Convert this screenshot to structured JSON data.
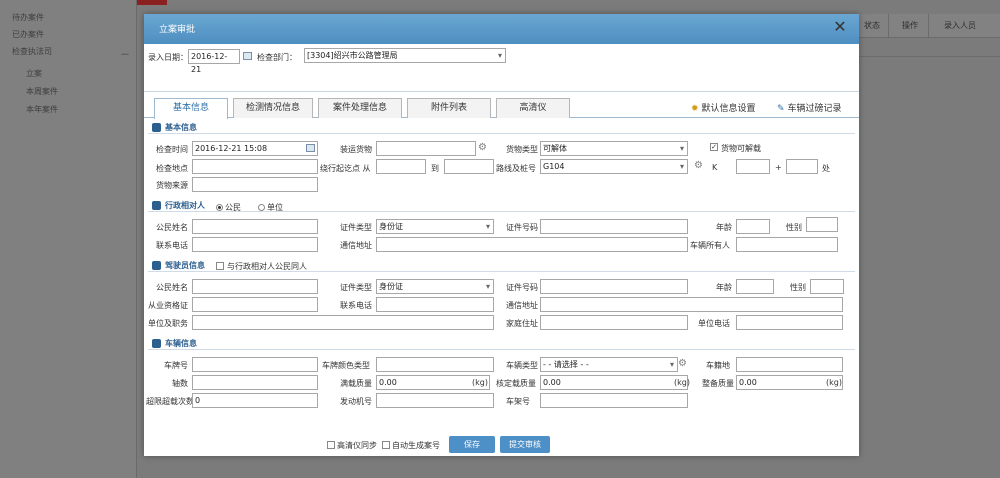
{
  "background": {
    "sidebar_items": [
      "待办案件",
      "已办案件",
      "检查执法司",
      "立案",
      "本周案件",
      "本年案件"
    ],
    "collapse_symbol": "－",
    "table_headers": [
      "状态",
      "操作",
      "录入人员"
    ]
  },
  "dialog": {
    "title": "立案审批",
    "close_symbol": "✕",
    "entry_date_label": "录入日期：",
    "entry_date_value": "2016-12-21",
    "check_dept_label": "检查部门：",
    "check_dept_value": "[3304]绍兴市公路管理局"
  },
  "tabs": [
    {
      "label": "基本信息",
      "active": true
    },
    {
      "label": "检测情况信息",
      "active": false
    },
    {
      "label": "案件处理信息",
      "active": false
    },
    {
      "label": "附件列表",
      "active": false
    },
    {
      "label": "高清仪",
      "active": false
    }
  ],
  "tab_links": {
    "default_settings": "默认信息设置",
    "vehicle_records": "车辆过磅记录"
  },
  "basic_info": {
    "section_title": "基本信息",
    "check_time_label": "检查时间",
    "check_time_value": "2016-12-21 15:08",
    "goods_label": "装运货物",
    "goods_type_label": "货物类型",
    "goods_type_value": "可解体",
    "goods_divisible_label": "货物可解载",
    "location_label": "检查地点",
    "detour_from_label": "绕行起讫点 从",
    "detour_to_label": "到",
    "route_label": "路线及桩号",
    "route_value": "G104",
    "k_label": "K",
    "plus_label": "+",
    "end_label": "处",
    "goods_source_label": "货物来源"
  },
  "party": {
    "section_title": "行政相对人",
    "option_citizen": "公民",
    "option_unit": "单位",
    "name_label": "公民姓名",
    "id_type_label": "证件类型",
    "id_type_value": "身份证",
    "id_no_label": "证件号码",
    "age_label": "年龄",
    "gender_label": "性别",
    "phone_label": "联系电话",
    "address_label": "通信地址",
    "owner_label": "车辆所有人"
  },
  "driver": {
    "section_title": "驾驶员信息",
    "same_person_label": "与行政相对人公民同人",
    "name_label": "公民姓名",
    "id_type_label": "证件类型",
    "id_type_value": "身份证",
    "id_no_label": "证件号码",
    "age_label": "年龄",
    "gender_label": "性别",
    "qual_label": "从业资格证",
    "phone_label": "联系电话",
    "address_label": "通信地址",
    "work_unit_label": "单位及职务",
    "home_addr_label": "家庭住址",
    "unit_phone_label": "单位电话"
  },
  "vehicle": {
    "section_title": "车辆信息",
    "plate_label": "车牌号",
    "plate_type_label": "车牌颜色类型",
    "vehicle_type_label": "车辆类型",
    "vehicle_type_value": "- - 请选择 - -",
    "reg_place_label": "车籍地",
    "axles_label": "轴数",
    "full_weight_label": "满载质量",
    "full_weight_value": "0.00",
    "rated_weight_label": "核定载质量",
    "rated_weight_value": "0.00",
    "curb_weight_label": "整备质量",
    "curb_weight_value": "0.00",
    "unit_kg": "(kg)",
    "overlimit_label": "超限超载次数",
    "overlimit_value": "0",
    "engine_label": "发动机号",
    "frame_label": "车架号"
  },
  "footer": {
    "hd_sync_label": "高清仪同步",
    "auto_generate_label": "自动生成案号",
    "save_label": "保存",
    "submit_label": "提交审核"
  }
}
